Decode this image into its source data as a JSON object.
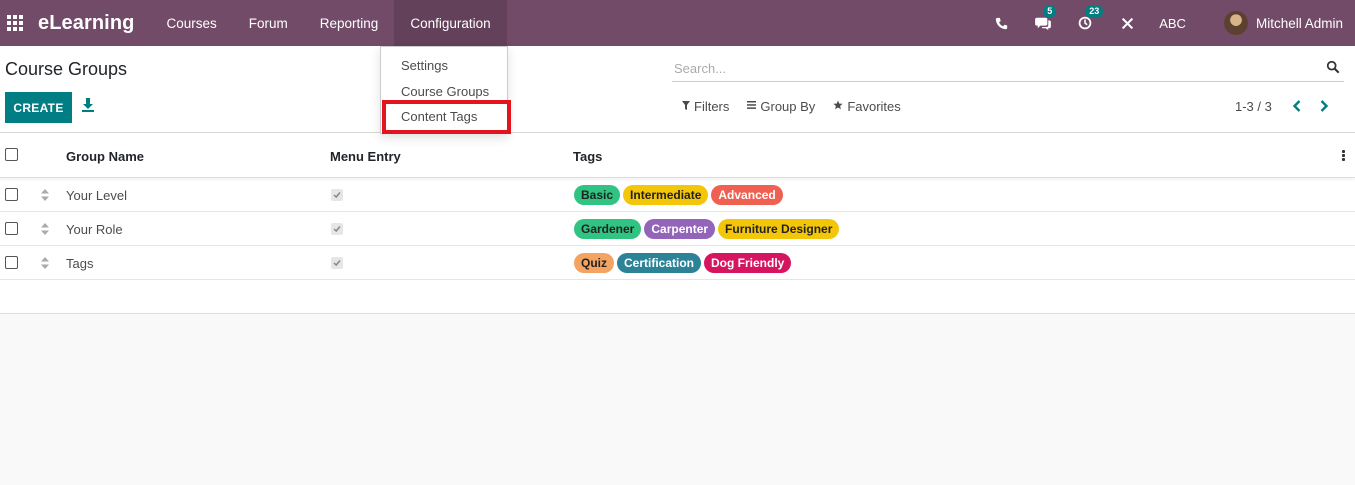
{
  "navbar": {
    "brand": "eLearning",
    "menus": [
      "Courses",
      "Forum",
      "Reporting",
      "Configuration"
    ],
    "chat_badge": "5",
    "activity_badge": "23",
    "company": "ABC",
    "user": "Mitchell Admin"
  },
  "config_dropdown": {
    "items": [
      "Settings",
      "Course Groups",
      "Content Tags"
    ],
    "highlighted": "Content Tags",
    "highlight_color": "#e3141e"
  },
  "control_panel": {
    "title": "Course Groups",
    "create_label": "CREATE",
    "search_placeholder": "Search...",
    "filters_label": "Filters",
    "groupby_label": "Group By",
    "favorites_label": "Favorites",
    "pager": "1-3 / 3"
  },
  "table": {
    "columns": [
      "Group Name",
      "Menu Entry",
      "Tags"
    ],
    "rows": [
      {
        "name": "Your Level",
        "menu_entry": true,
        "tags": [
          {
            "label": "Basic",
            "color": "#30c381",
            "text": "dark-text"
          },
          {
            "label": "Intermediate",
            "color": "#f4c609",
            "text": "dark-text"
          },
          {
            "label": "Advanced",
            "color": "#f06050",
            "text": "light-text"
          }
        ]
      },
      {
        "name": "Your Role",
        "menu_entry": true,
        "tags": [
          {
            "label": "Gardener",
            "color": "#30c381",
            "text": "dark-text"
          },
          {
            "label": "Carpenter",
            "color": "#9365b8",
            "text": "light-text"
          },
          {
            "label": "Furniture Designer",
            "color": "#f4c609",
            "text": "dark-text"
          }
        ]
      },
      {
        "name": "Tags",
        "menu_entry": true,
        "tags": [
          {
            "label": "Quiz",
            "color": "#f4a460",
            "text": "dark-text"
          },
          {
            "label": "Certification",
            "color": "#2c8397",
            "text": "light-text"
          },
          {
            "label": "Dog Friendly",
            "color": "#d6145f",
            "text": "light-text"
          }
        ]
      }
    ]
  },
  "colors": {
    "brand": "#714b67",
    "primary_button": "#017e84"
  }
}
